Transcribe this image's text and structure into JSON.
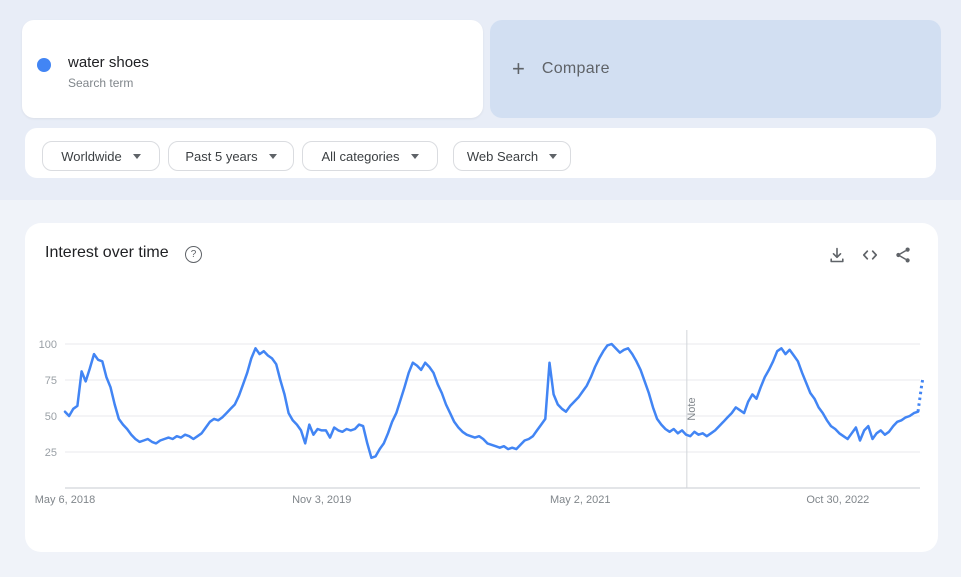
{
  "colors": {
    "accent_blue": "#4285f4",
    "top_background": "#e8edf7",
    "page_background": "#f0f3f9",
    "compare_card_background": "#d2dff2",
    "gridline": "#e8eaed",
    "axis_line": "#c7cbd1",
    "note_line": "#d2d5da",
    "muted_text": "#80868b",
    "tick_text": "#9aa0a6"
  },
  "search_card": {
    "term": "water shoes",
    "type_label": "Search term",
    "dot_icon": "series-color-dot"
  },
  "compare_card": {
    "plus": "+",
    "label": "Compare"
  },
  "filters": {
    "region": "Worldwide",
    "time": "Past 5 years",
    "category": "All categories",
    "search_type": "Web Search"
  },
  "chart_card": {
    "title": "Interest over time",
    "help_icon": "?",
    "action_icons": [
      "download-icon",
      "embed-code-icon",
      "share-icon"
    ]
  },
  "chart_data": {
    "type": "line",
    "title": "Interest over time",
    "xlabel": "",
    "ylabel": "",
    "ylim": [
      0,
      100
    ],
    "y_ticks": [
      25,
      50,
      75,
      100
    ],
    "grid": true,
    "x_tick_labels": [
      "May 6, 2018",
      "Nov 3, 2019",
      "May 2, 2021",
      "Oct 30, 2022"
    ],
    "x_tick_fractions": [
      0.0,
      0.301,
      0.604,
      0.906
    ],
    "annotation": {
      "label": "Note",
      "x_fraction": 0.729
    },
    "series": [
      {
        "name": "water shoes",
        "color": "#4285f4",
        "values": [
          53,
          50,
          55,
          57,
          81,
          74,
          83,
          93,
          89,
          88,
          77,
          70,
          58,
          48,
          44,
          41,
          37,
          34,
          32,
          33,
          34,
          32,
          31,
          33,
          34,
          35,
          34,
          36,
          35,
          37,
          36,
          34,
          36,
          38,
          42,
          46,
          48,
          47,
          49,
          52,
          55,
          58,
          64,
          72,
          80,
          90,
          97,
          93,
          95,
          92,
          90,
          86,
          75,
          65,
          52,
          47,
          44,
          40,
          31,
          44,
          37,
          41,
          40,
          40,
          35,
          42,
          40,
          39,
          41,
          40,
          41,
          44,
          43,
          31,
          21,
          22,
          27,
          31,
          38,
          46,
          52,
          61,
          70,
          80,
          87,
          85,
          82,
          87,
          84,
          80,
          72,
          66,
          58,
          52,
          46,
          42,
          39,
          37,
          36,
          35,
          36,
          34,
          31,
          30,
          29,
          28,
          29,
          27,
          28,
          27,
          30,
          33,
          34,
          36,
          40,
          44,
          48,
          87,
          65,
          58,
          55,
          53,
          57,
          60,
          63,
          67,
          71,
          77,
          84,
          90,
          95,
          99,
          100,
          97,
          94,
          96,
          97,
          93,
          88,
          82,
          74,
          66,
          56,
          48,
          44,
          41,
          39,
          41,
          38,
          40,
          37,
          36,
          39,
          37,
          38,
          36,
          38,
          40,
          43,
          46,
          49,
          52,
          56,
          54,
          52,
          60,
          65,
          62,
          70,
          77,
          82,
          88,
          95,
          97,
          93,
          96,
          92,
          88,
          80,
          73,
          66,
          62,
          56,
          52,
          47,
          43,
          41,
          38,
          36,
          34,
          38,
          42,
          33,
          40,
          43,
          34,
          38,
          40,
          37,
          39,
          43,
          46,
          47,
          49,
          50,
          52,
          53
        ],
        "partial_dotted_values": [
          53,
          59,
          65,
          71,
          76
        ]
      }
    ]
  }
}
